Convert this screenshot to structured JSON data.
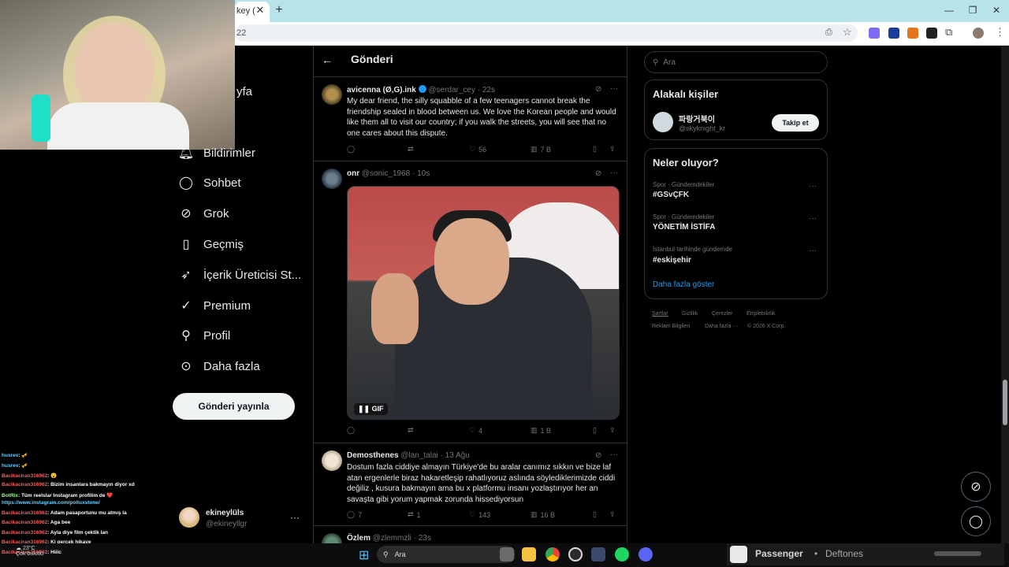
{
  "browser": {
    "tab_title": "key (",
    "address_text": "22"
  },
  "nav": {
    "partial_top": "yfa",
    "items": [
      {
        "label": "Bildirimler",
        "icon": "bell-icon"
      },
      {
        "label": "Sohbet",
        "icon": "chat-icon"
      },
      {
        "label": "Grok",
        "icon": "grok-icon"
      },
      {
        "label": "Geçmiş",
        "icon": "bookmark-icon"
      },
      {
        "label": "İçerik Üreticisi St...",
        "icon": "rocket-icon"
      },
      {
        "label": "Premium",
        "icon": "premium-icon"
      },
      {
        "label": "Profil",
        "icon": "profile-icon"
      },
      {
        "label": "Daha fazla",
        "icon": "more-circle-icon"
      }
    ],
    "post_button": "Gönderi yayınla",
    "profile": {
      "name": "ekineylüls",
      "handle": "@ekineyllgr",
      "more": "···"
    }
  },
  "feed": {
    "back": "←",
    "title": "Gönderi",
    "tweets": [
      {
        "name": "avicenna (Ø,G).ink",
        "handle": "@serdar_cey · 22s",
        "text": "My dear friend, the silly squabble of a few teenagers cannot break the friendship sealed in blood between us. We love the Korean people and would like them all to visit our country; if you walk the streets, you will see that no one cares about this dispute.",
        "replies": "",
        "retweets": "",
        "likes": "56",
        "views": "7 B"
      },
      {
        "name": "onr",
        "handle": "@sonic_1968 · 10s",
        "gif_label": "GIF",
        "replies": "",
        "retweets": "",
        "likes": "4",
        "views": "1 B"
      },
      {
        "name": "Demosthenes",
        "handle": "@lan_talai · 13 Ağu",
        "text": "Dostum fazla ciddiye almayın Türkiye'de bu aralar canımız sıkkın ve bize laf atan ergenlerle biraz hakaretleşip rahatlıyoruz aslında söyledikler­imizde ciddi değiliz , kusura bakmayın ama bu x platformu insanı yozlaştırıyor her an savaşta gibi yorum yapmak zorunda hissediyorsun",
        "replies": "7",
        "retweets": "1",
        "likes": "143",
        "views": "16 B"
      },
      {
        "name": "Özlem",
        "handle": "@zlemmzli · 23s"
      }
    ]
  },
  "sidebar": {
    "search_placeholder": "Ara",
    "related_title": "Alakalı kişiler",
    "related_person": {
      "name": "파랑거북이",
      "handle": "@skyknight_kr",
      "follow": "Takip et"
    },
    "trends_title": "Neler oluyor?",
    "trends": [
      {
        "category": "Spor · Gündemdekiler",
        "name": "#GSvÇFK"
      },
      {
        "category": "Spor · Gündemdekiler",
        "name": "YÖNETİM İSTİFA"
      },
      {
        "category": "İstanbul tarihinde gündemde",
        "name": "#eskişehir"
      }
    ],
    "show_more": "Daha fazla göster",
    "footer": [
      "Şartlar",
      "Gizlilik",
      "Çerezler",
      "Erişilebilirlik",
      "Reklam Bilgileri",
      "Daha fazla ···",
      "© 2026 X Corp."
    ]
  },
  "chat": [
    {
      "user": "husrev",
      "msg": "🎺",
      "color": "u2"
    },
    {
      "user": "husrev",
      "msg": "🎺",
      "color": "u2"
    },
    {
      "user": "Bacikaciran316962",
      "msg": "😮",
      "color": "u"
    },
    {
      "user": "Bacikaciran316962",
      "msg": "Bizim insanlara bakmayın diyor xd",
      "color": "u"
    },
    {
      "user": "BotRix",
      "msg": "Tüm reelslar Instagram profilim de ❤️",
      "color": "u3"
    },
    {
      "user": "",
      "msg": "https://www.instagram.com/polluxstone/",
      "color": "u2"
    },
    {
      "user": "Bacikaciran316962",
      "msg": "Adam pasaportunu mu atmış la",
      "color": "u"
    },
    {
      "user": "Bacikaciran316962",
      "msg": "Aga bee",
      "color": "u"
    },
    {
      "user": "Bacikaciran316962",
      "msg": "Ayla diye film çektik lan",
      "color": "u"
    },
    {
      "user": "Bacikaciran316962",
      "msg": "Ki gerçek hikaye",
      "color": "u"
    },
    {
      "user": "Bacikaciran316962",
      "msg": "Hiiic",
      "color": "u"
    }
  ],
  "taskbar": {
    "search": "Ara",
    "weather_temp": "23°C",
    "weather_desc": "Çok bulutlu",
    "media_title": "Passenger",
    "media_dot": "•",
    "media_artist": "Deftones"
  },
  "colors": {
    "accent": "#1d9bf0",
    "bg": "#000000",
    "border": "#2f3336",
    "muted": "#71767b"
  }
}
